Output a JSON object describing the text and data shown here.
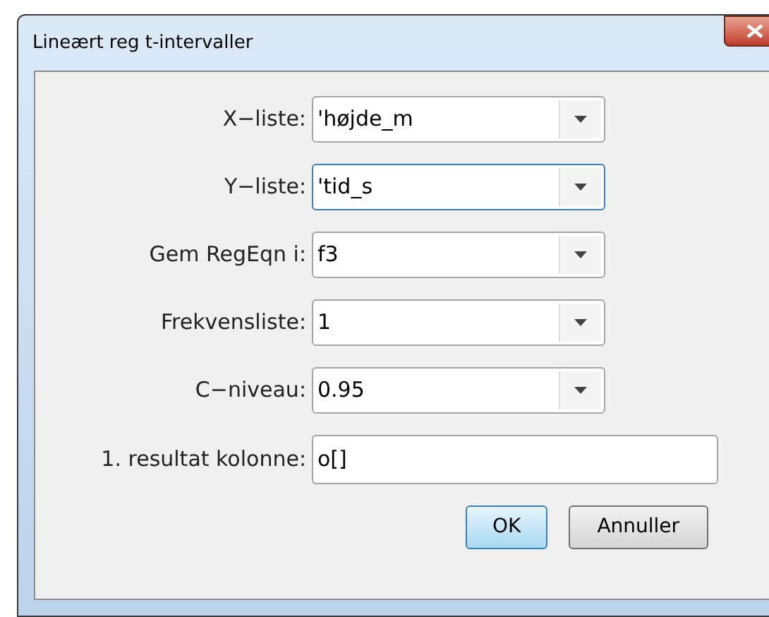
{
  "window": {
    "title": "Lineært reg t-intervaller"
  },
  "fields": [
    {
      "kind": "combo",
      "label": "X−liste:",
      "value": "'højde_m",
      "focused": false
    },
    {
      "kind": "combo",
      "label": "Y−liste:",
      "value": "'tid_s",
      "focused": true
    },
    {
      "kind": "combo",
      "label": "Gem RegEqn i:",
      "value": "f3",
      "focused": false
    },
    {
      "kind": "combo",
      "label": "Frekvensliste:",
      "value": "1",
      "focused": false
    },
    {
      "kind": "combo",
      "label": "C−niveau:",
      "value": "0.95",
      "focused": false
    },
    {
      "kind": "text",
      "label": "1. resultat kolonne:",
      "value": "o[]",
      "focused": false
    }
  ],
  "buttons": [
    {
      "label": "OK",
      "default": true
    },
    {
      "label": "Annuller",
      "default": false
    }
  ]
}
